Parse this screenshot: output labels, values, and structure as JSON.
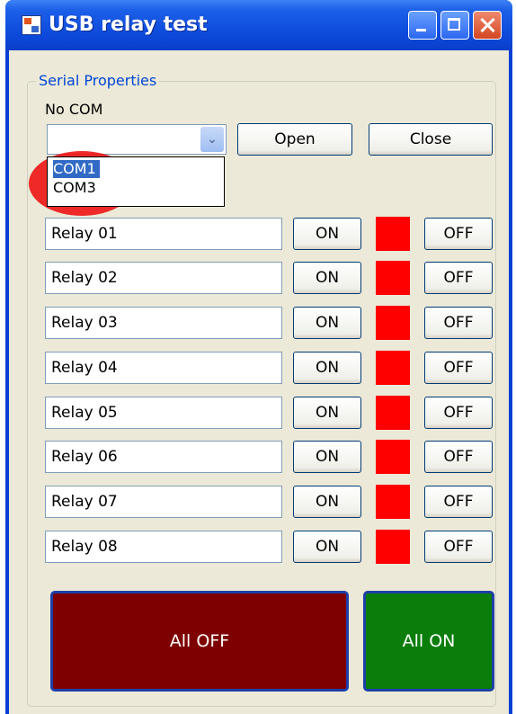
{
  "window": {
    "title": "USB relay test"
  },
  "serial": {
    "group_label": "Serial Properties",
    "status": "No COM",
    "combo_value": "",
    "ports": [
      "COM1",
      "COM3"
    ],
    "open_label": "Open",
    "close_label": "Close"
  },
  "relays": [
    {
      "name": "Relay 01",
      "on_label": "ON",
      "off_label": "OFF",
      "state_color": "#ff0000"
    },
    {
      "name": "Relay 02",
      "on_label": "ON",
      "off_label": "OFF",
      "state_color": "#ff0000"
    },
    {
      "name": "Relay 03",
      "on_label": "ON",
      "off_label": "OFF",
      "state_color": "#ff0000"
    },
    {
      "name": "Relay 04",
      "on_label": "ON",
      "off_label": "OFF",
      "state_color": "#ff0000"
    },
    {
      "name": "Relay 05",
      "on_label": "ON",
      "off_label": "OFF",
      "state_color": "#ff0000"
    },
    {
      "name": "Relay 06",
      "on_label": "ON",
      "off_label": "OFF",
      "state_color": "#ff0000"
    },
    {
      "name": "Relay 07",
      "on_label": "ON",
      "off_label": "OFF",
      "state_color": "#ff0000"
    },
    {
      "name": "Relay 08",
      "on_label": "ON",
      "off_label": "OFF",
      "state_color": "#ff0000"
    }
  ],
  "all_off": {
    "label": "All OFF",
    "color": "#7e0000"
  },
  "all_on": {
    "label": "All ON",
    "color": "#0b7d0b"
  },
  "icons": {
    "app": "app-window-icon",
    "minimize": "minimize-icon",
    "maximize": "maximize-icon",
    "close": "close-icon",
    "dropdown": "chevron-down-icon"
  }
}
